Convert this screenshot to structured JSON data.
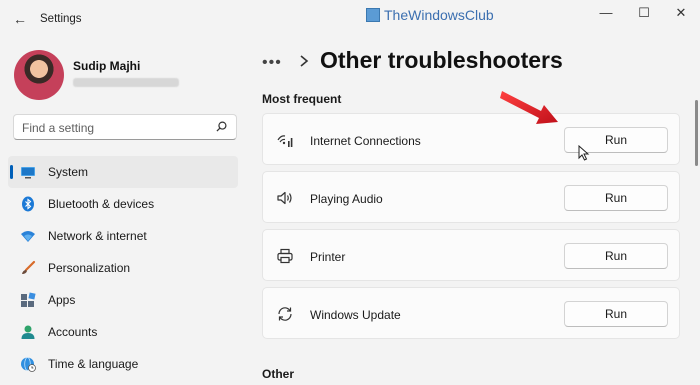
{
  "window": {
    "title": "Settings",
    "watermark": "TheWindowsClub",
    "controls": {
      "minimize": "—",
      "maximize": "☐",
      "close": "✕"
    }
  },
  "profile": {
    "name": "Sudip Majhi"
  },
  "search": {
    "placeholder": "Find a setting"
  },
  "sidebar": {
    "items": [
      {
        "label": "System",
        "icon": "system-icon",
        "active": true
      },
      {
        "label": "Bluetooth & devices",
        "icon": "bluetooth-icon"
      },
      {
        "label": "Network & internet",
        "icon": "wifi-icon"
      },
      {
        "label": "Personalization",
        "icon": "brush-icon"
      },
      {
        "label": "Apps",
        "icon": "apps-icon"
      },
      {
        "label": "Accounts",
        "icon": "accounts-icon"
      },
      {
        "label": "Time & language",
        "icon": "globe-clock-icon"
      }
    ]
  },
  "breadcrumb": {
    "dots": "•••",
    "title": "Other troubleshooters"
  },
  "sections": {
    "most_frequent": "Most frequent",
    "other": "Other"
  },
  "troubleshooters": [
    {
      "label": "Internet Connections",
      "icon": "network-signal-icon",
      "button": "Run"
    },
    {
      "label": "Playing Audio",
      "icon": "speaker-icon",
      "button": "Run"
    },
    {
      "label": "Printer",
      "icon": "printer-icon",
      "button": "Run"
    },
    {
      "label": "Windows Update",
      "icon": "sync-icon",
      "button": "Run"
    }
  ],
  "colors": {
    "accent": "#005fb8",
    "annotation": "#e0202a",
    "background": "#f3f3f3"
  }
}
